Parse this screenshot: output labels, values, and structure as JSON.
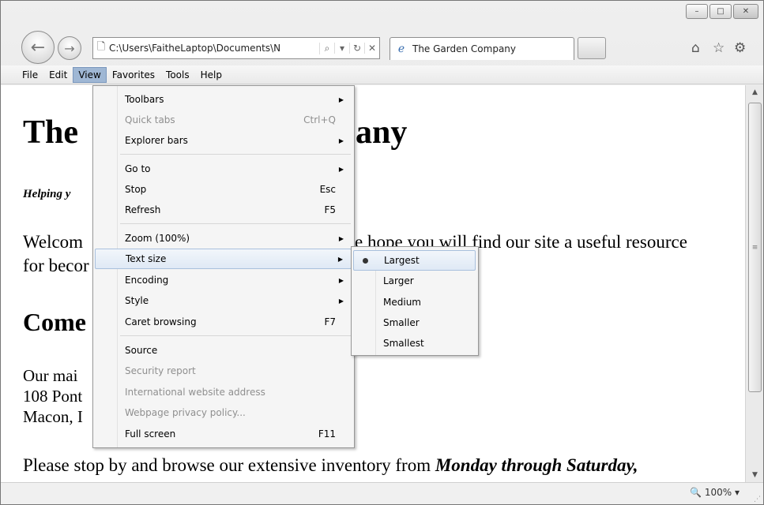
{
  "browser": {
    "address_url": "C:\\Users\\FaitheLaptop\\Documents\\N",
    "tab_title": "The Garden Company",
    "icons": [
      "back-icon",
      "forward-icon",
      "page-icon",
      "search-icon",
      "dropdown-icon",
      "refresh-icon",
      "stop-icon",
      "ie-icon",
      "home-icon",
      "favorites-star-icon",
      "gear-icon"
    ]
  },
  "window_controls": {
    "minimize": "–",
    "maximize": "□",
    "close": "✕"
  },
  "menubar": {
    "file": "File",
    "edit": "Edit",
    "view": "View",
    "favorites": "Favorites",
    "tools": "Tools",
    "help": "Help"
  },
  "page": {
    "title": "The Garden Company",
    "title_visible_left": "The",
    "title_visible_right": "any",
    "tagline_visible": "Helping y",
    "welcome_left_1": "Welcom",
    "welcome_right_1": "e hope you will find our site a useful resource",
    "welcome_left_2": "for becor",
    "heading2_visible": "Come",
    "address_line_1": "Our mai",
    "address_line_2": "108 Pont",
    "address_line_3": "Macon, I",
    "hours_text": "Please stop by and browse our extensive inventory from ",
    "hours_emph": "Monday through Saturday,"
  },
  "view_menu": {
    "items": [
      {
        "label": "Toolbars",
        "shortcut": "",
        "submenu": true,
        "disabled": false
      },
      {
        "label": "Quick tabs",
        "shortcut": "Ctrl+Q",
        "submenu": false,
        "disabled": true
      },
      {
        "label": "Explorer bars",
        "shortcut": "",
        "submenu": true,
        "disabled": false
      },
      {
        "label": "Go to",
        "shortcut": "",
        "submenu": true,
        "disabled": false
      },
      {
        "label": "Stop",
        "shortcut": "Esc",
        "submenu": false,
        "disabled": false
      },
      {
        "label": "Refresh",
        "shortcut": "F5",
        "submenu": false,
        "disabled": false
      },
      {
        "label": "Zoom (100%)",
        "shortcut": "",
        "submenu": true,
        "disabled": false
      },
      {
        "label": "Text size",
        "shortcut": "",
        "submenu": true,
        "disabled": false,
        "highlighted": true
      },
      {
        "label": "Encoding",
        "shortcut": "",
        "submenu": true,
        "disabled": false
      },
      {
        "label": "Style",
        "shortcut": "",
        "submenu": true,
        "disabled": false
      },
      {
        "label": "Caret browsing",
        "shortcut": "F7",
        "submenu": false,
        "disabled": false
      },
      {
        "label": "Source",
        "shortcut": "",
        "submenu": false,
        "disabled": false
      },
      {
        "label": "Security report",
        "shortcut": "",
        "submenu": false,
        "disabled": true
      },
      {
        "label": "International website address",
        "shortcut": "",
        "submenu": false,
        "disabled": true
      },
      {
        "label": "Webpage privacy policy...",
        "shortcut": "",
        "submenu": false,
        "disabled": true
      },
      {
        "label": "Full screen",
        "shortcut": "F11",
        "submenu": false,
        "disabled": false
      }
    ]
  },
  "text_size_menu": {
    "items": [
      {
        "label": "Largest",
        "selected": true
      },
      {
        "label": "Larger",
        "selected": false
      },
      {
        "label": "Medium",
        "selected": false
      },
      {
        "label": "Smaller",
        "selected": false
      },
      {
        "label": "Smallest",
        "selected": false
      }
    ]
  },
  "statusbar": {
    "zoom": "100%"
  }
}
